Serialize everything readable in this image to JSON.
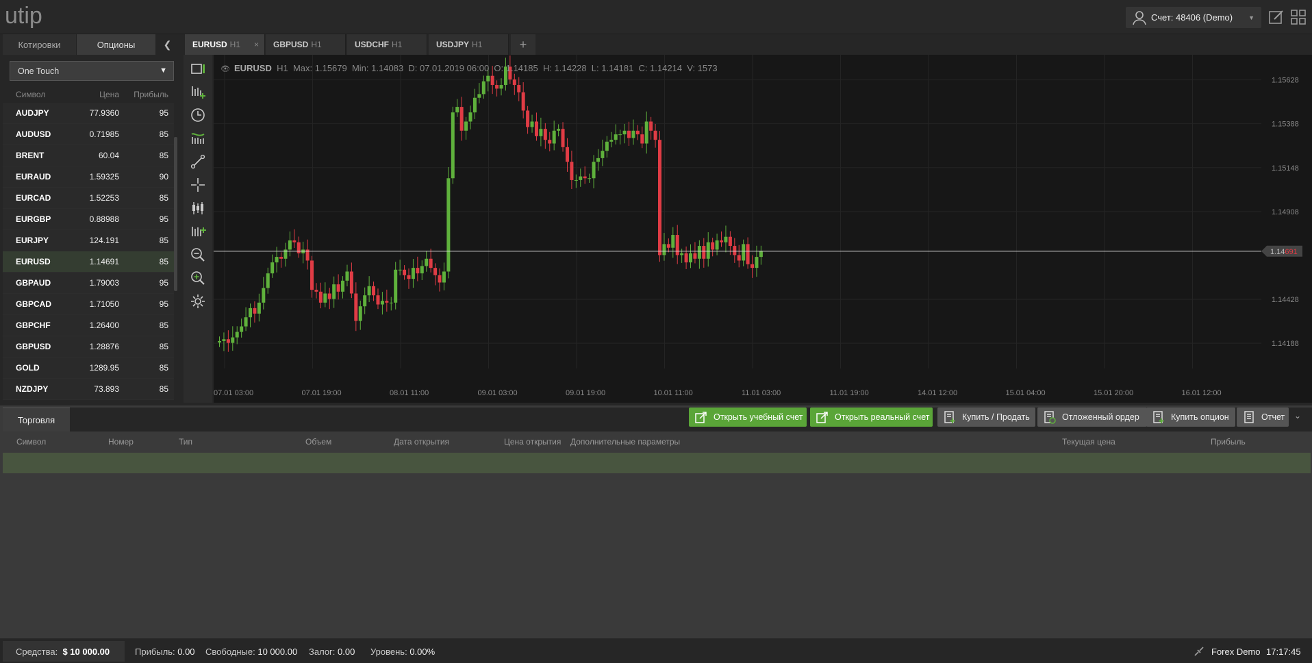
{
  "header": {
    "logo": "utip",
    "account": "Счет: 48406 (Demo)"
  },
  "left": {
    "tabs": [
      "Котировки",
      "Опционы"
    ],
    "select_value": "One Touch",
    "columns": [
      "Символ",
      "Цена",
      "Прибыль"
    ],
    "rows": [
      {
        "symbol": "AUDJPY",
        "price": "77.9360",
        "profit": "95"
      },
      {
        "symbol": "AUDUSD",
        "price": "0.71985",
        "profit": "85"
      },
      {
        "symbol": "BRENT",
        "price": "60.04",
        "profit": "85"
      },
      {
        "symbol": "EURAUD",
        "price": "1.59325",
        "profit": "90"
      },
      {
        "symbol": "EURCAD",
        "price": "1.52253",
        "profit": "85"
      },
      {
        "symbol": "EURGBP",
        "price": "0.88988",
        "profit": "95"
      },
      {
        "symbol": "EURJPY",
        "price": "124.191",
        "profit": "85"
      },
      {
        "symbol": "EURUSD",
        "price": "1.14691",
        "profit": "85"
      },
      {
        "symbol": "GBPAUD",
        "price": "1.79003",
        "profit": "95"
      },
      {
        "symbol": "GBPCAD",
        "price": "1.71050",
        "profit": "95"
      },
      {
        "symbol": "GBPCHF",
        "price": "1.26400",
        "profit": "85"
      },
      {
        "symbol": "GBPUSD",
        "price": "1.28876",
        "profit": "85"
      },
      {
        "symbol": "GOLD",
        "price": "1289.95",
        "profit": "85"
      },
      {
        "symbol": "NZDJPY",
        "price": "73.893",
        "profit": "85"
      }
    ],
    "selected_symbol": "EURUSD"
  },
  "chart_tabs": [
    {
      "symbol": "EURUSD",
      "tf": "H1",
      "active": true
    },
    {
      "symbol": "GBPUSD",
      "tf": "H1",
      "active": false
    },
    {
      "symbol": "USDCHF",
      "tf": "H1",
      "active": false
    },
    {
      "symbol": "USDJPY",
      "tf": "H1",
      "active": false
    }
  ],
  "chart_info": {
    "symbol": "EURUSD",
    "tf": "H1",
    "text": "Max: 1.15679  Min: 1.14083  D: 07.01.2019 06:00  O: 1.14185  H: 1.14228  L: 1.14181  C: 1.14214  V: 1573"
  },
  "chart_data": {
    "type": "candlestick",
    "symbol": "EURUSD",
    "timeframe": "H1",
    "ylim": [
      1.1405,
      1.1572
    ],
    "y_ticks": [
      "1.15628",
      "1.15388",
      "1.15148",
      "1.14908",
      "1.14428",
      "1.14188"
    ],
    "x_ticks": [
      "07.01 03:00",
      "07.01 19:00",
      "08.01 11:00",
      "09.01 03:00",
      "09.01 19:00",
      "10.01 11:00",
      "11.01 03:00",
      "11.01 19:00",
      "14.01 12:00",
      "15.01 04:00",
      "15.01 20:00",
      "16.01 12:00"
    ],
    "current_price": "1.14691",
    "current_price_prefix": "1.14",
    "current_price_suffix": "691",
    "closes": [
      1.142,
      1.1421,
      1.1419,
      1.1422,
      1.1425,
      1.1428,
      1.1433,
      1.1438,
      1.1435,
      1.1441,
      1.1449,
      1.1457,
      1.1463,
      1.1466,
      1.1465,
      1.147,
      1.1475,
      1.1474,
      1.1468,
      1.147,
      1.1464,
      1.1448,
      1.1447,
      1.1441,
      1.1446,
      1.1443,
      1.1451,
      1.1447,
      1.1453,
      1.1458,
      1.1446,
      1.1431,
      1.1439,
      1.1445,
      1.145,
      1.1445,
      1.144,
      1.1442,
      1.1441,
      1.1441,
      1.1459,
      1.1459,
      1.1456,
      1.1454,
      1.146,
      1.1457,
      1.1461,
      1.1465,
      1.146,
      1.1456,
      1.1452,
      1.1458,
      1.1509,
      1.1545,
      1.1548,
      1.1535,
      1.154,
      1.1545,
      1.1553,
      1.1555,
      1.1562,
      1.1565,
      1.156,
      1.1558,
      1.156,
      1.157,
      1.1563,
      1.156,
      1.1556,
      1.1546,
      1.1537,
      1.154,
      1.1532,
      1.1536,
      1.153,
      1.1528,
      1.1535,
      1.1536,
      1.1526,
      1.1518,
      1.1508,
      1.1508,
      1.151,
      1.1509,
      1.1509,
      1.1518,
      1.152,
      1.1524,
      1.1529,
      1.153,
      1.1533,
      1.1533,
      1.1535,
      1.1531,
      1.1535,
      1.1533,
      1.1528,
      1.154,
      1.1535,
      1.153,
      1.1467,
      1.1473,
      1.1471,
      1.1478,
      1.1467,
      1.1468,
      1.1463,
      1.1468,
      1.1465,
      1.1472,
      1.1465,
      1.1474,
      1.147,
      1.1475,
      1.1474,
      1.1477,
      1.1472,
      1.1467,
      1.1464,
      1.1473,
      1.1462,
      1.146,
      1.1466,
      1.1469
    ],
    "grid": true,
    "colors": {
      "up": "#5fb13c",
      "down": "#e03c45",
      "background": "#171717",
      "grid": "#242424",
      "price_line": "#dddddd"
    }
  },
  "bottom": {
    "tab": "Торговля",
    "buttons": [
      "Открыть учебный счет",
      "Открыть реальный счет",
      "Купить / Продать",
      "Отложенный ордер",
      "Купить опцион",
      "Отчет"
    ],
    "columns": [
      "Символ",
      "Номер",
      "Тип",
      "Объем",
      "Дата открытия",
      "Цена открытия",
      "Дополнительные параметры",
      "Текущая цена",
      "Прибыль"
    ]
  },
  "status": {
    "funds_label": "Средства:",
    "funds_value": "$ 10 000.00",
    "profit_label": "Прибыль:",
    "profit_value": "0.00",
    "free_label": "Свободные:",
    "free_value": "10 000.00",
    "margin_label": "Залог:",
    "margin_value": "0.00",
    "level_label": "Уровень:",
    "level_value": "0.00%",
    "server": "Forex Demo",
    "time": "17:17:45"
  }
}
